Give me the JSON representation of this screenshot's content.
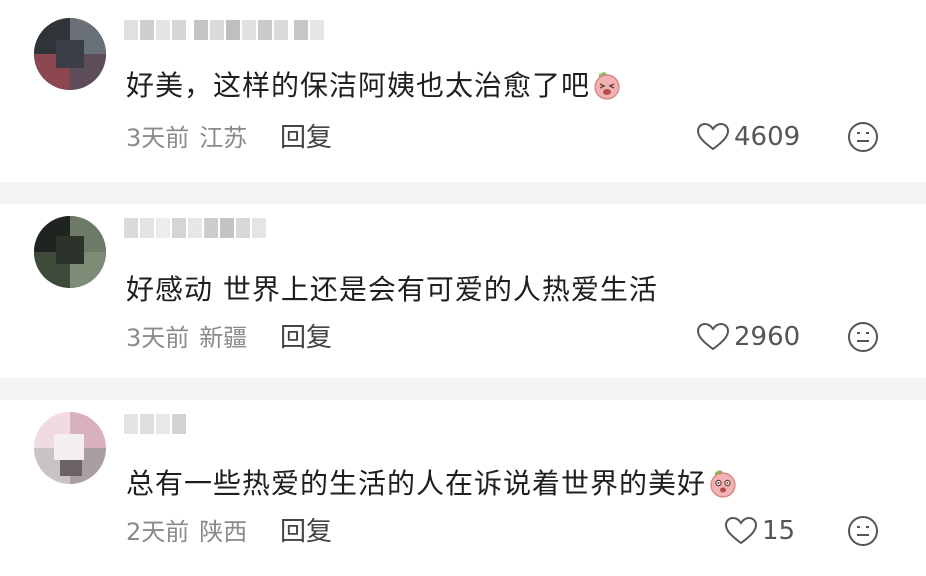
{
  "comments": [
    {
      "text": "好美，这样的保洁阿姨也太治愈了吧",
      "time": "3天前",
      "location": "江苏",
      "reply_label": "回复",
      "likes": "4609",
      "emoji": "peach-laugh-emoji"
    },
    {
      "text": "好感动 世界上还是会有可爱的人热爱生活",
      "time": "3天前",
      "location": "新疆",
      "reply_label": "回复",
      "likes": "2960",
      "emoji": ""
    },
    {
      "text": "总有一些热爱的生活的人在诉说着世界的美好",
      "time": "2天前",
      "location": "陕西",
      "reply_label": "回复",
      "likes": "15",
      "emoji": "peach-cry-emoji"
    }
  ],
  "icons": {
    "like": "heart-outline-icon",
    "react": "smiley-face-icon"
  },
  "colors": {
    "background": "#f3f3f3",
    "card": "#ffffff",
    "text": "#1f1f1f",
    "meta": "#8a8a8a",
    "emoji_peach": "#f2a3a3"
  }
}
